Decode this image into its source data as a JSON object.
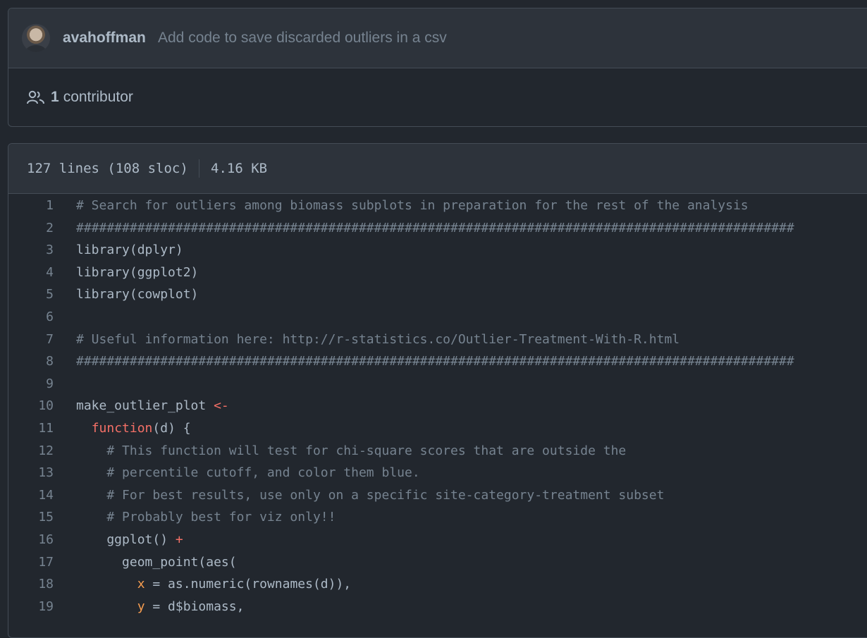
{
  "commit": {
    "author": "avahoffman",
    "message": "Add code to save discarded outliers in a csv"
  },
  "contributors": {
    "count": "1",
    "label": "contributor"
  },
  "file_info": {
    "lines": "127 lines (108 sloc)",
    "size": "4.16 KB"
  },
  "colors": {
    "background": "#22272e",
    "header": "#2d333b",
    "comment": "#768390",
    "keyword": "#f47067",
    "argument": "#f69d50",
    "text": "#adbac7"
  },
  "code": [
    {
      "n": "1",
      "tokens": [
        {
          "t": "# Search for outliers among biomass subplots in preparation for the rest of the analysis",
          "c": "c"
        }
      ]
    },
    {
      "n": "2",
      "tokens": [
        {
          "t": "##############################################################################################",
          "c": "c"
        }
      ]
    },
    {
      "n": "3",
      "tokens": [
        {
          "t": "library(dplyr)",
          "c": "p"
        }
      ]
    },
    {
      "n": "4",
      "tokens": [
        {
          "t": "library(ggplot2)",
          "c": "p"
        }
      ]
    },
    {
      "n": "5",
      "tokens": [
        {
          "t": "library(cowplot)",
          "c": "p"
        }
      ]
    },
    {
      "n": "6",
      "tokens": []
    },
    {
      "n": "7",
      "tokens": [
        {
          "t": "# Useful information here: http://r-statistics.co/Outlier-Treatment-With-R.html",
          "c": "c"
        }
      ]
    },
    {
      "n": "8",
      "tokens": [
        {
          "t": "##############################################################################################",
          "c": "c"
        }
      ]
    },
    {
      "n": "9",
      "tokens": []
    },
    {
      "n": "10",
      "tokens": [
        {
          "t": "make_outlier_plot ",
          "c": "p"
        },
        {
          "t": "<-",
          "c": "o"
        }
      ]
    },
    {
      "n": "11",
      "tokens": [
        {
          "t": "  ",
          "c": "p"
        },
        {
          "t": "function",
          "c": "k"
        },
        {
          "t": "(d) {",
          "c": "p"
        }
      ]
    },
    {
      "n": "12",
      "tokens": [
        {
          "t": "    # This function will test for chi-square scores that are outside the",
          "c": "c"
        }
      ]
    },
    {
      "n": "13",
      "tokens": [
        {
          "t": "    # percentile cutoff, and color them blue.",
          "c": "c"
        }
      ]
    },
    {
      "n": "14",
      "tokens": [
        {
          "t": "    # For best results, use only on a specific site-category-treatment subset",
          "c": "c"
        }
      ]
    },
    {
      "n": "15",
      "tokens": [
        {
          "t": "    # Probably best for viz only!!",
          "c": "c"
        }
      ]
    },
    {
      "n": "16",
      "tokens": [
        {
          "t": "    ggplot() ",
          "c": "p"
        },
        {
          "t": "+",
          "c": "o"
        }
      ]
    },
    {
      "n": "17",
      "tokens": [
        {
          "t": "      geom_point(aes(",
          "c": "p"
        }
      ]
    },
    {
      "n": "18",
      "tokens": [
        {
          "t": "        ",
          "c": "p"
        },
        {
          "t": "x",
          "c": "v"
        },
        {
          "t": " = as.numeric(rownames(d)),",
          "c": "p"
        }
      ]
    },
    {
      "n": "19",
      "tokens": [
        {
          "t": "        ",
          "c": "p"
        },
        {
          "t": "y",
          "c": "v"
        },
        {
          "t": " = d$biomass,",
          "c": "p"
        }
      ]
    }
  ]
}
